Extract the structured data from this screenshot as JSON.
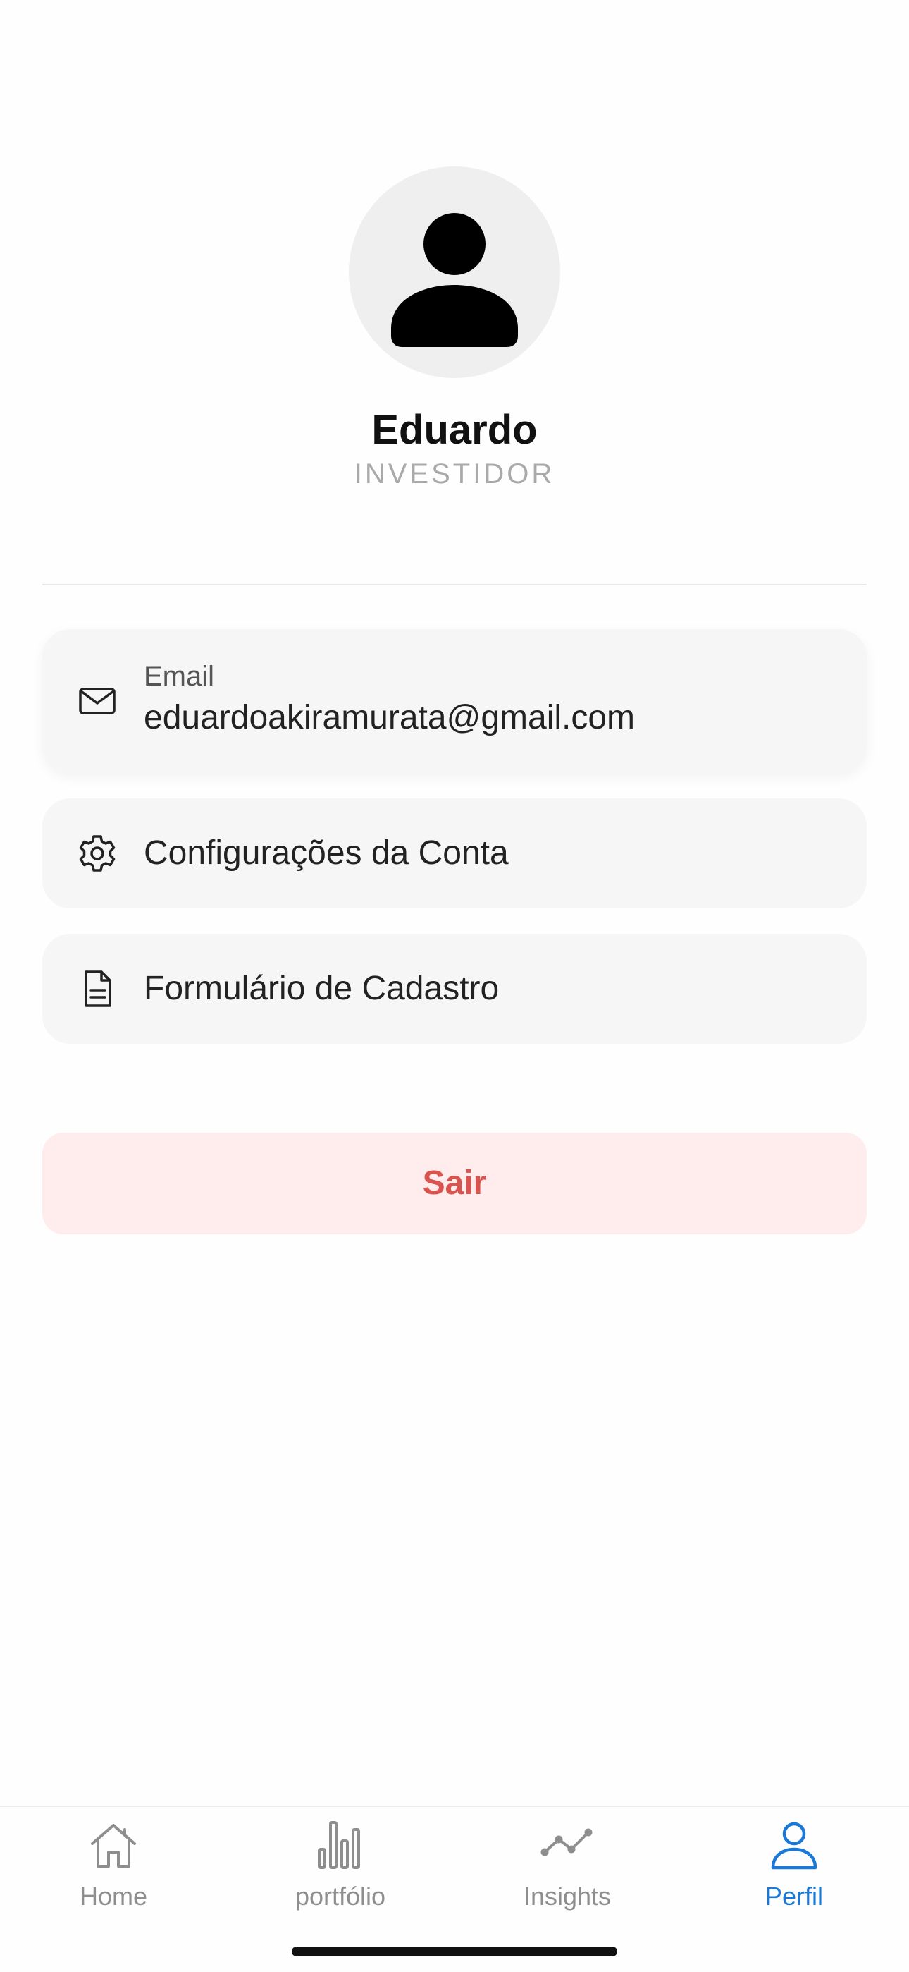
{
  "profile": {
    "name": "Eduardo",
    "role": "INVESTIDOR",
    "avatar_icon": "person-icon"
  },
  "cards": {
    "email": {
      "icon": "mail-icon",
      "label": "Email",
      "value": "eduardoakiramurata@gmail.com"
    },
    "settings": {
      "icon": "gear-icon",
      "label": "Configurações da Conta"
    },
    "form": {
      "icon": "document-icon",
      "label": "Formulário de Cadastro"
    }
  },
  "logout": {
    "label": "Sair",
    "color": "#d9534f",
    "background": "#ffecec"
  },
  "tabbar": {
    "active_color": "#1a78d6",
    "inactive_color": "#8e8e8e",
    "tabs": [
      {
        "label": "Home",
        "icon": "home-icon",
        "active": false
      },
      {
        "label": "portfólio",
        "icon": "bar-chart-icon",
        "active": false
      },
      {
        "label": "Insights",
        "icon": "trend-line-icon",
        "active": false
      },
      {
        "label": "Perfil",
        "icon": "person-icon",
        "active": true
      }
    ]
  }
}
